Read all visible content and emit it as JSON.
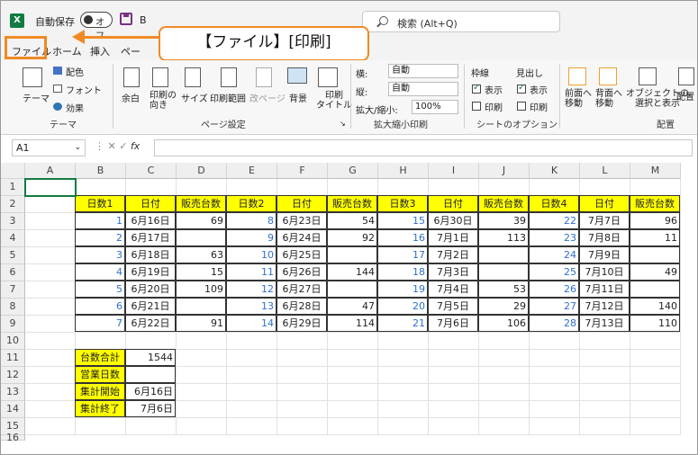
{
  "titlebar": {
    "autosave_label": "自動保存",
    "autosave_state": "オフ",
    "book_name": "B",
    "search_placeholder": "検索 (Alt+Q)"
  },
  "tabs": [
    {
      "label": "ファイル",
      "active": false,
      "highlighted": true
    },
    {
      "label": "ホーム"
    },
    {
      "label": "挿入"
    },
    {
      "label": "ペー"
    }
  ],
  "callout": {
    "text": "【ファイル】[印刷]"
  },
  "ribbon": {
    "theme_group": {
      "label": "テーマ",
      "buttons": [
        {
          "label": "テーマ"
        },
        {
          "label": "配色"
        },
        {
          "label": "フォント"
        },
        {
          "label": "効果"
        }
      ]
    },
    "page_setup_group": {
      "label": "ページ設定",
      "buttons": [
        {
          "label": "余白"
        },
        {
          "label": "印刷の\n向き"
        },
        {
          "label": "サイズ"
        },
        {
          "label": "印刷範囲"
        },
        {
          "label": "改ページ"
        },
        {
          "label": "背景"
        },
        {
          "label": "印刷\nタイトル"
        }
      ]
    },
    "scale_group": {
      "label": "拡大縮小印刷",
      "width_label": "横:",
      "width_value": "自動",
      "height_label": "縦:",
      "height_value": "自動",
      "scale_label": "拡大/縮小:",
      "scale_value": "100%"
    },
    "sheet_options_group": {
      "label": "シートのオプション",
      "gridlines_label": "枠線",
      "headings_label": "見出し",
      "gridlines_view_label": "表示",
      "gridlines_print_label": "印刷",
      "headings_view_label": "表示",
      "headings_print_label": "印刷"
    },
    "arrange_group": {
      "label": "配置",
      "buttons": [
        {
          "label": "前面へ\n移動"
        },
        {
          "label": "背面へ\n移動"
        },
        {
          "label": "オブジェクトの\n選択と表示"
        },
        {
          "label": "配置"
        }
      ]
    }
  },
  "formula_bar": {
    "name_box": "A1",
    "fx_label": "fx",
    "formula": ""
  },
  "sheet": {
    "columns": [
      "A",
      "B",
      "C",
      "D",
      "E",
      "F",
      "G",
      "H",
      "I",
      "J",
      "K",
      "L",
      "M"
    ],
    "rows": [
      "1",
      "2",
      "3",
      "4",
      "5",
      "6",
      "7",
      "8",
      "9",
      "10",
      "11",
      "12",
      "13",
      "14",
      "15",
      "16"
    ],
    "header_row": [
      "日数1",
      "日付",
      "販売台数",
      "日数2",
      "日付",
      "販売台数",
      "日数3",
      "日付",
      "販売台数",
      "日数4",
      "日付",
      "販売台数"
    ],
    "data_rows": [
      [
        "1",
        "6月16日",
        "69",
        "8",
        "6月23日",
        "54",
        "15",
        "6月30日",
        "39",
        "22",
        "7月7日",
        "96"
      ],
      [
        "2",
        "6月17日",
        "",
        "9",
        "6月24日",
        "92",
        "16",
        "7月1日",
        "113",
        "23",
        "7月8日",
        "11"
      ],
      [
        "3",
        "6月18日",
        "63",
        "10",
        "6月25日",
        "",
        "17",
        "7月2日",
        "",
        "24",
        "7月9日",
        ""
      ],
      [
        "4",
        "6月19日",
        "15",
        "11",
        "6月26日",
        "144",
        "18",
        "7月3日",
        "",
        "25",
        "7月10日",
        "49"
      ],
      [
        "5",
        "6月20日",
        "109",
        "12",
        "6月27日",
        "",
        "19",
        "7月4日",
        "53",
        "26",
        "7月11日",
        ""
      ],
      [
        "6",
        "6月21日",
        "",
        "13",
        "6月28日",
        "47",
        "20",
        "7月5日",
        "29",
        "27",
        "7月12日",
        "140"
      ],
      [
        "7",
        "6月22日",
        "91",
        "14",
        "6月29日",
        "114",
        "21",
        "7月6日",
        "106",
        "28",
        "7月13日",
        "110"
      ]
    ],
    "summary": [
      {
        "label": "台数合計",
        "value": "1544"
      },
      {
        "label": "営業日数",
        "value": ""
      },
      {
        "label": "集計開始",
        "value": "6月16日"
      },
      {
        "label": "集計終了",
        "value": "7月6日"
      }
    ]
  },
  "colors": {
    "accent": "#107c41",
    "callout_border": "#f08a24",
    "header_fill": "#ffff00",
    "number_text": "#2f6fcf"
  }
}
